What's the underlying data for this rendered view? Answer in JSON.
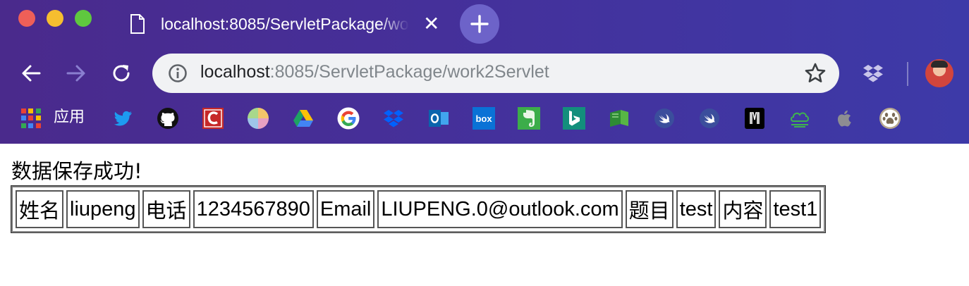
{
  "browser": {
    "tab_title": "localhost:8085/ServletPackage/work2Servlet",
    "new_tab_symbol": "+",
    "close_symbol": "✕",
    "address": {
      "host": "localhost",
      "rest": ":8085/ServletPackage/work2Servlet"
    },
    "bookmarks": {
      "apps_label": "应用",
      "items": [
        "twitter-icon",
        "github-icon",
        "c-app-icon",
        "color-wheel-icon",
        "google-drive-icon",
        "google-icon",
        "dropbox-icon",
        "outlook-icon",
        "box-icon",
        "evernote-icon",
        "bing-icon",
        "green-book-icon",
        "swift-icon",
        "swift-icon",
        "m-app-icon",
        "cloud-icon",
        "apple-icon",
        "paw-icon"
      ]
    },
    "colors": {
      "chrome_purple": "#45309a",
      "omnibox_bg": "#f1f2f4"
    }
  },
  "page": {
    "message": "数据保存成功!",
    "record": [
      {
        "label": "姓名",
        "value": "liupeng"
      },
      {
        "label": "电话",
        "value": "1234567890"
      },
      {
        "label": "Email",
        "value": "LIUPENG.0@outlook.com"
      },
      {
        "label": "题目",
        "value": "test"
      },
      {
        "label": "内容",
        "value": "test1"
      }
    ]
  }
}
